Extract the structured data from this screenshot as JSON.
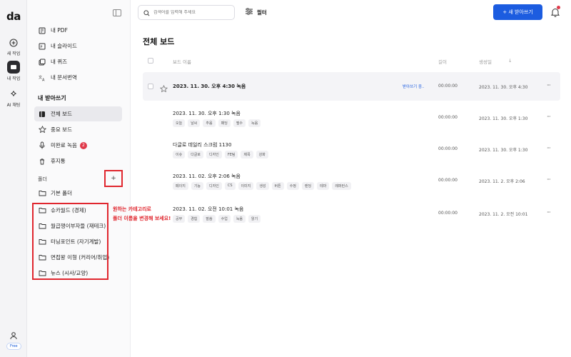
{
  "rail": {
    "logo": "da",
    "items": [
      {
        "label": "새 작업",
        "icon": "plus-circle-icon"
      },
      {
        "label": "내 작업",
        "icon": "folder-icon"
      },
      {
        "label": "AI 채팅",
        "icon": "sparkle-icon"
      }
    ],
    "free_label": "Free"
  },
  "sidebar": {
    "tools": [
      {
        "label": "내 PDF",
        "icon": "pdf-icon"
      },
      {
        "label": "내 슬라이드",
        "icon": "slide-icon"
      },
      {
        "label": "내 퀴즈",
        "icon": "quiz-icon"
      },
      {
        "label": "내 문서번역",
        "icon": "translate-icon"
      }
    ],
    "section_title": "내 받아쓰기",
    "nav": [
      {
        "label": "전체 보드",
        "icon": "board-icon",
        "selected": true
      },
      {
        "label": "중요 보드",
        "icon": "star-icon"
      },
      {
        "label": "미완료 녹음",
        "icon": "mic-icon",
        "badge": "2"
      },
      {
        "label": "휴지통",
        "icon": "trash-icon"
      }
    ],
    "folder_title": "폴더",
    "add_folder": "+",
    "folders": [
      {
        "label": "기본 폴더"
      },
      {
        "label": "슈카월드 (경제)"
      },
      {
        "label": "월급쟁이부자들 (재테크)"
      },
      {
        "label": "터닝포인트 (자기계발)"
      },
      {
        "label": "면접왕 이형 (커리어/취업)"
      },
      {
        "label": "뉴스 (시사/교양)"
      }
    ],
    "annotation": {
      "line1": "원하는 카테고리로",
      "line2": "폴더 이름을 변경해 보세요!"
    }
  },
  "header": {
    "search_placeholder": "검색어를 입력해 주세요",
    "filter_label": "필터",
    "new_button": "+ 새 받아쓰기"
  },
  "main": {
    "title": "전체 보드",
    "columns": {
      "name": "보드 이름",
      "length": "길이",
      "created": "생성일",
      "sort": "↓"
    },
    "rows": [
      {
        "title": "2023. 11. 30. 오후 4:30 녹음",
        "status": "받아쓰기 중..",
        "length": "00:00:00",
        "date": "2023. 11. 30. 오후 4:30",
        "tags": [],
        "more": "···"
      },
      {
        "title": "2023. 11. 30. 오후 1:30 녹음",
        "length": "00:00:00",
        "date": "2023. 11. 30. 오후 1:30",
        "tags": [
          "오늘",
          "날씨",
          "추움",
          "패딩",
          "필수",
          "녹음"
        ],
        "more": "···"
      },
      {
        "title": "다글로 데일리 스크럼 1130",
        "length": "00:00:00",
        "date": "2023. 11. 30. 오후 1:30",
        "tags": [
          "이슈",
          "다글로",
          "디자인",
          "FE팀",
          "제목",
          "강화"
        ],
        "more": "···"
      },
      {
        "title": "2023. 11. 02. 오후 2:06 녹음",
        "length": "00:00:00",
        "date": "2023. 11. 2. 오후 2:06",
        "tags": [
          "페이지",
          "기능",
          "디자인",
          "CS",
          "이미지",
          "생성",
          "버튼",
          "수정",
          "랜딩",
          "테마",
          "레퍼런스"
        ],
        "more": "···"
      },
      {
        "title": "2023. 11. 02. 오전 10:01 녹음",
        "length": "00:00:00",
        "date": "2023. 11. 2. 오전 10:01",
        "tags": [
          "공부",
          "경험",
          "말씀",
          "수업",
          "녹음",
          "읽기"
        ],
        "more": "···"
      }
    ]
  },
  "colors": {
    "accent": "#1c5ce0",
    "highlight": "#e0262e",
    "badge": "#e0394a"
  }
}
